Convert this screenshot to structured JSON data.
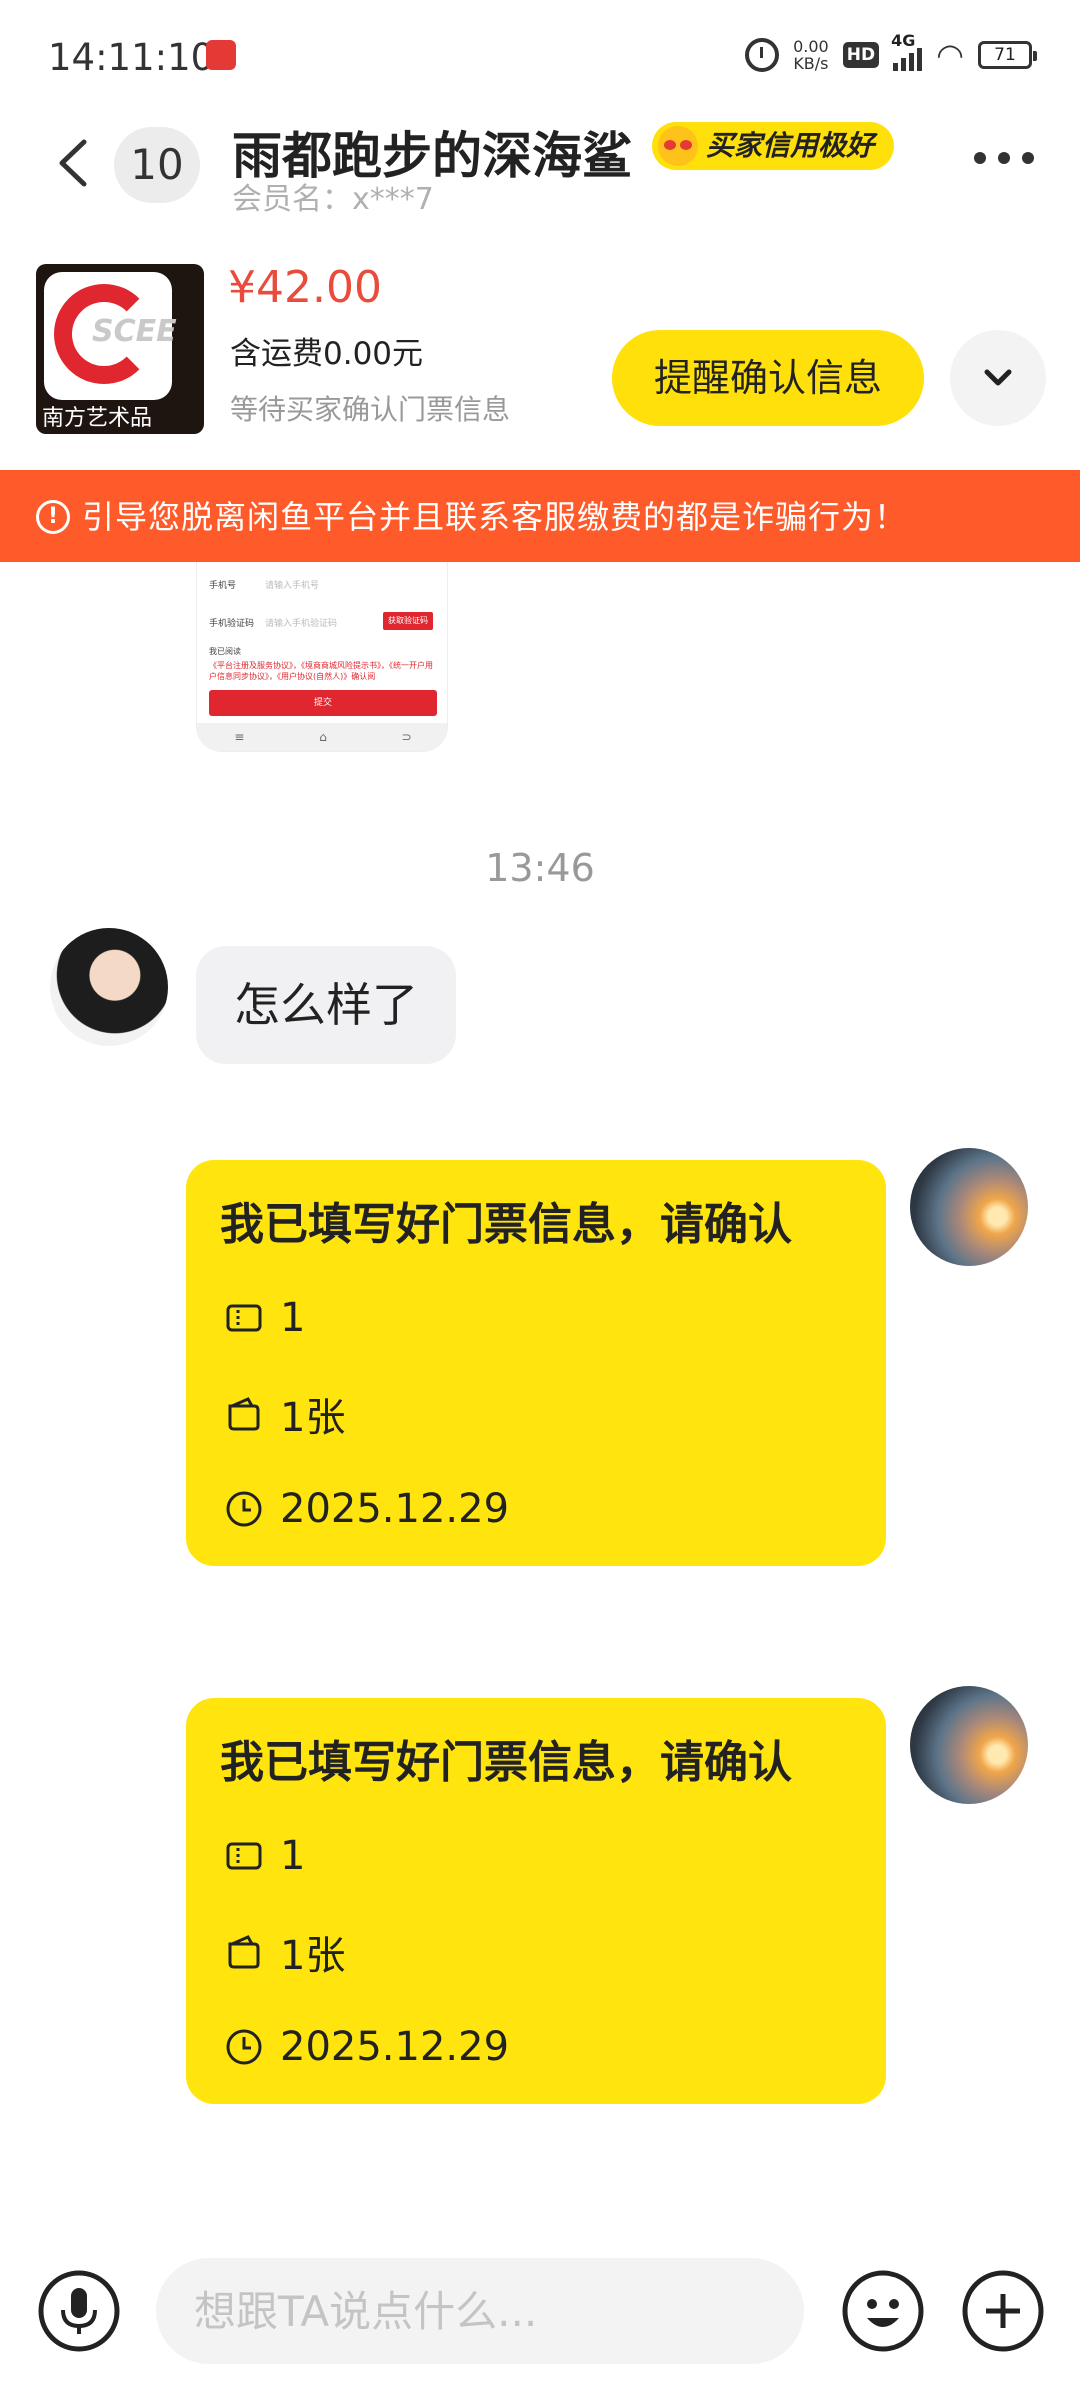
{
  "status_bar": {
    "time": "14:11:10",
    "net_speed_value": "0.00",
    "net_speed_unit": "KB/s",
    "hd": "HD",
    "network": "4G",
    "battery": "71"
  },
  "header": {
    "unread_count": "10",
    "chat_name": "雨都跑步的深海鲨",
    "credit_badge": "买家信用极好",
    "member_name": "会员名：x***7"
  },
  "product": {
    "image_caption": "南方艺术品",
    "logo_text": "SCEE",
    "price": "¥42.00",
    "shipping": "含运费0.00元",
    "status": "等待买家确认门票信息",
    "remind_button": "提醒确认信息"
  },
  "warning": {
    "icon_text": "!",
    "text": "引导您脱离闲鱼平台并且联系客服缴费的都是诈骗行为！"
  },
  "shared_screenshot": {
    "phone_label": "手机号",
    "phone_placeholder": "请输入手机号",
    "code_label": "手机验证码",
    "code_placeholder": "请输入手机验证码",
    "get_code": "获取验证码",
    "agree_check": "我已阅读",
    "agreements": "《平台注册及服务协议》，《境商商城风险提示书》，《统一开户用户信息同步协议》，《用户协议(自然人)》确认阅",
    "submit": "提交"
  },
  "chat": {
    "timestamp": "13:46",
    "received_message": "怎么样了",
    "cards": [
      {
        "title": "我已填写好门票信息，请确认",
        "ticket_count": "1",
        "quantity": "1张",
        "date": "2025.12.29"
      },
      {
        "title": "我已填写好门票信息，请确认",
        "ticket_count": "1",
        "quantity": "1张",
        "date": "2025.12.29"
      }
    ]
  },
  "input_bar": {
    "placeholder": "想跟TA说点什么..."
  },
  "colors": {
    "brand_yellow": "#ffe40e",
    "warning_orange": "#ff5a2a",
    "price_red": "#e94b3c"
  }
}
